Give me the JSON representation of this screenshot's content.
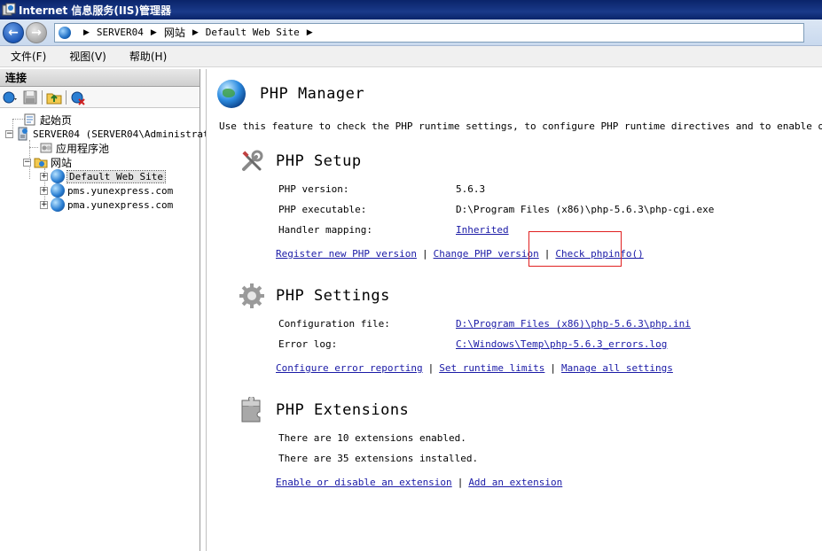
{
  "window": {
    "title": "Internet 信息服务(IIS)管理器"
  },
  "address": {
    "crumbs": [
      "SERVER04",
      "网站",
      "Default Web Site"
    ]
  },
  "menu": {
    "items": [
      "文件(F)",
      "视图(V)",
      "帮助(H)"
    ]
  },
  "connections": {
    "header": "连接",
    "tree": {
      "start_page": "起始页",
      "server": "SERVER04 (SERVER04\\Administrat",
      "app_pools": "应用程序池",
      "sites": "网站",
      "site1": "Default Web Site",
      "site2": "pms.yunexpress.com",
      "site3": "pma.yunexpress.com"
    }
  },
  "main": {
    "title": "PHP Manager",
    "description": "Use this feature to check the PHP runtime settings, to configure PHP runtime directives and to enable or disable P",
    "setup": {
      "title": "PHP Setup",
      "version_label": "PHP version:",
      "version_value": "5.6.3",
      "exe_label": "PHP executable:",
      "exe_value": "D:\\Program Files (x86)\\php-5.6.3\\php-cgi.exe",
      "handler_label": "Handler mapping:",
      "handler_value": "Inherited",
      "action_register": "Register new PHP version",
      "action_change": "Change PHP version",
      "action_phpinfo": "Check phpinfo()"
    },
    "settings": {
      "title": "PHP Settings",
      "config_label": "Configuration file:",
      "config_value": "D:\\Program Files (x86)\\php-5.6.3\\php.ini",
      "errorlog_label": "Error log:",
      "errorlog_value": "C:\\Windows\\Temp\\php-5.6.3_errors.log",
      "action_error_reporting": "Configure error reporting",
      "action_runtime_limits": "Set runtime limits",
      "action_manage_all": "Manage all settings"
    },
    "extensions": {
      "title": "PHP Extensions",
      "enabled_text": "There are 10 extensions enabled.",
      "installed_text": "There are 35 extensions installed.",
      "action_enable_disable": "Enable or disable an extension",
      "action_add": "Add an extension"
    }
  },
  "colors": {
    "link": "#1a1aa6",
    "highlight": "#e02020",
    "titlebar": "#0a246a"
  },
  "icons": {
    "back": "back-arrow-icon",
    "forward": "forward-arrow-icon",
    "setup": "wrench-screwdriver-icon",
    "settings": "gear-icon",
    "extensions": "puzzle-piece-icon"
  }
}
